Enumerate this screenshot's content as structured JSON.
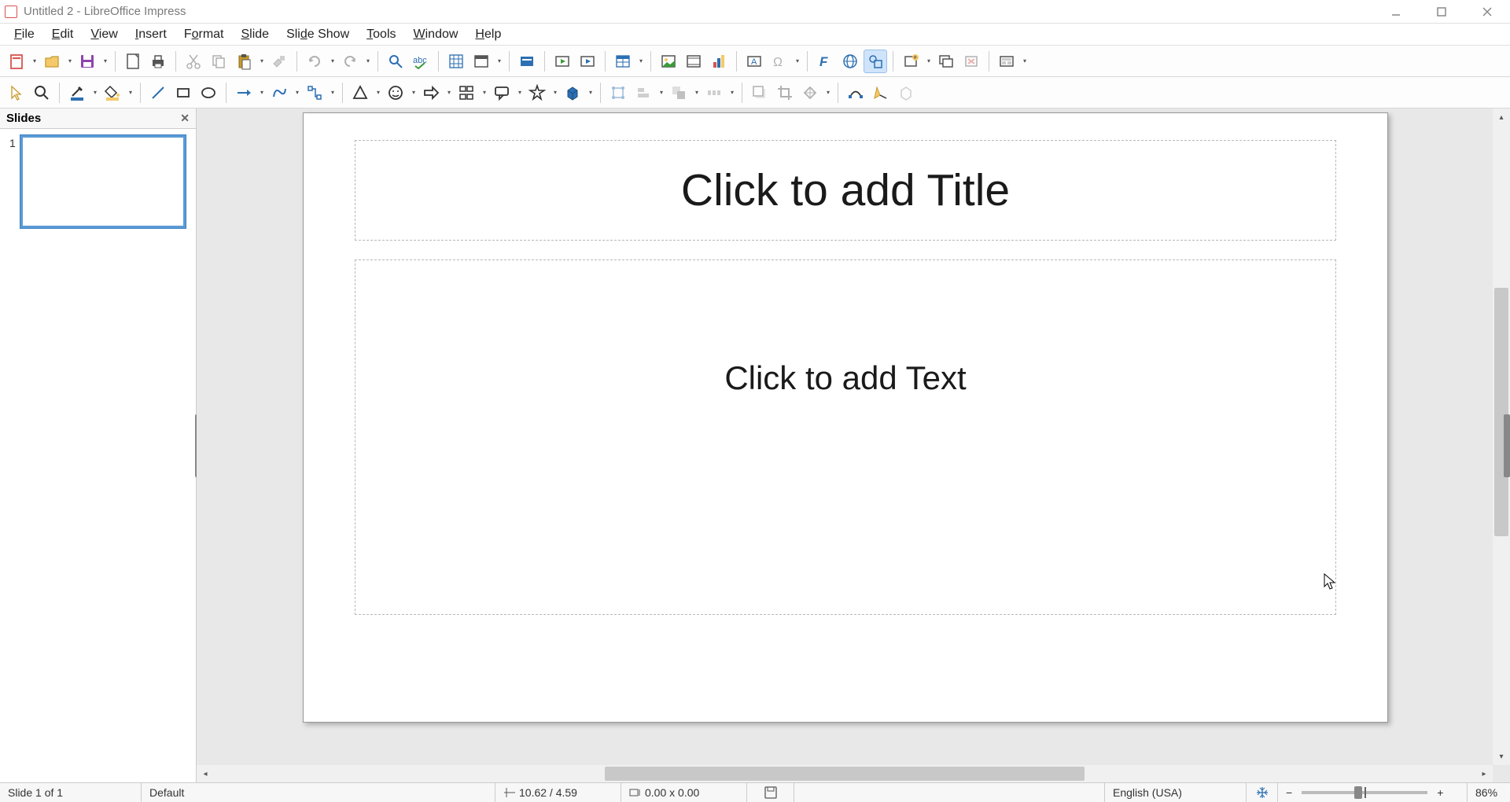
{
  "window": {
    "title": "Untitled 2 - LibreOffice Impress"
  },
  "menubar": {
    "items": [
      {
        "label": "File",
        "ul": "F"
      },
      {
        "label": "Edit",
        "ul": "E"
      },
      {
        "label": "View",
        "ul": "V"
      },
      {
        "label": "Insert",
        "ul": "I"
      },
      {
        "label": "Format",
        "ul": "F"
      },
      {
        "label": "Slide",
        "ul": "S"
      },
      {
        "label": "Slide Show",
        "ul": "S"
      },
      {
        "label": "Tools",
        "ul": "T"
      },
      {
        "label": "Window",
        "ul": "W"
      },
      {
        "label": "Help",
        "ul": "H"
      }
    ]
  },
  "slides_panel": {
    "title": "Slides",
    "items": [
      {
        "num": "1"
      }
    ]
  },
  "canvas": {
    "title_placeholder": "Click to add Title",
    "content_placeholder": "Click to add Text"
  },
  "statusbar": {
    "slide_counter": "Slide 1 of 1",
    "master": "Default",
    "cursor_pos": "10.62 / 4.59",
    "object_size": "0.00 x 0.00",
    "language": "English (USA)",
    "zoom_pct": "86%"
  },
  "icons": {
    "minus": "−",
    "plus": "+",
    "dd": "▾"
  }
}
